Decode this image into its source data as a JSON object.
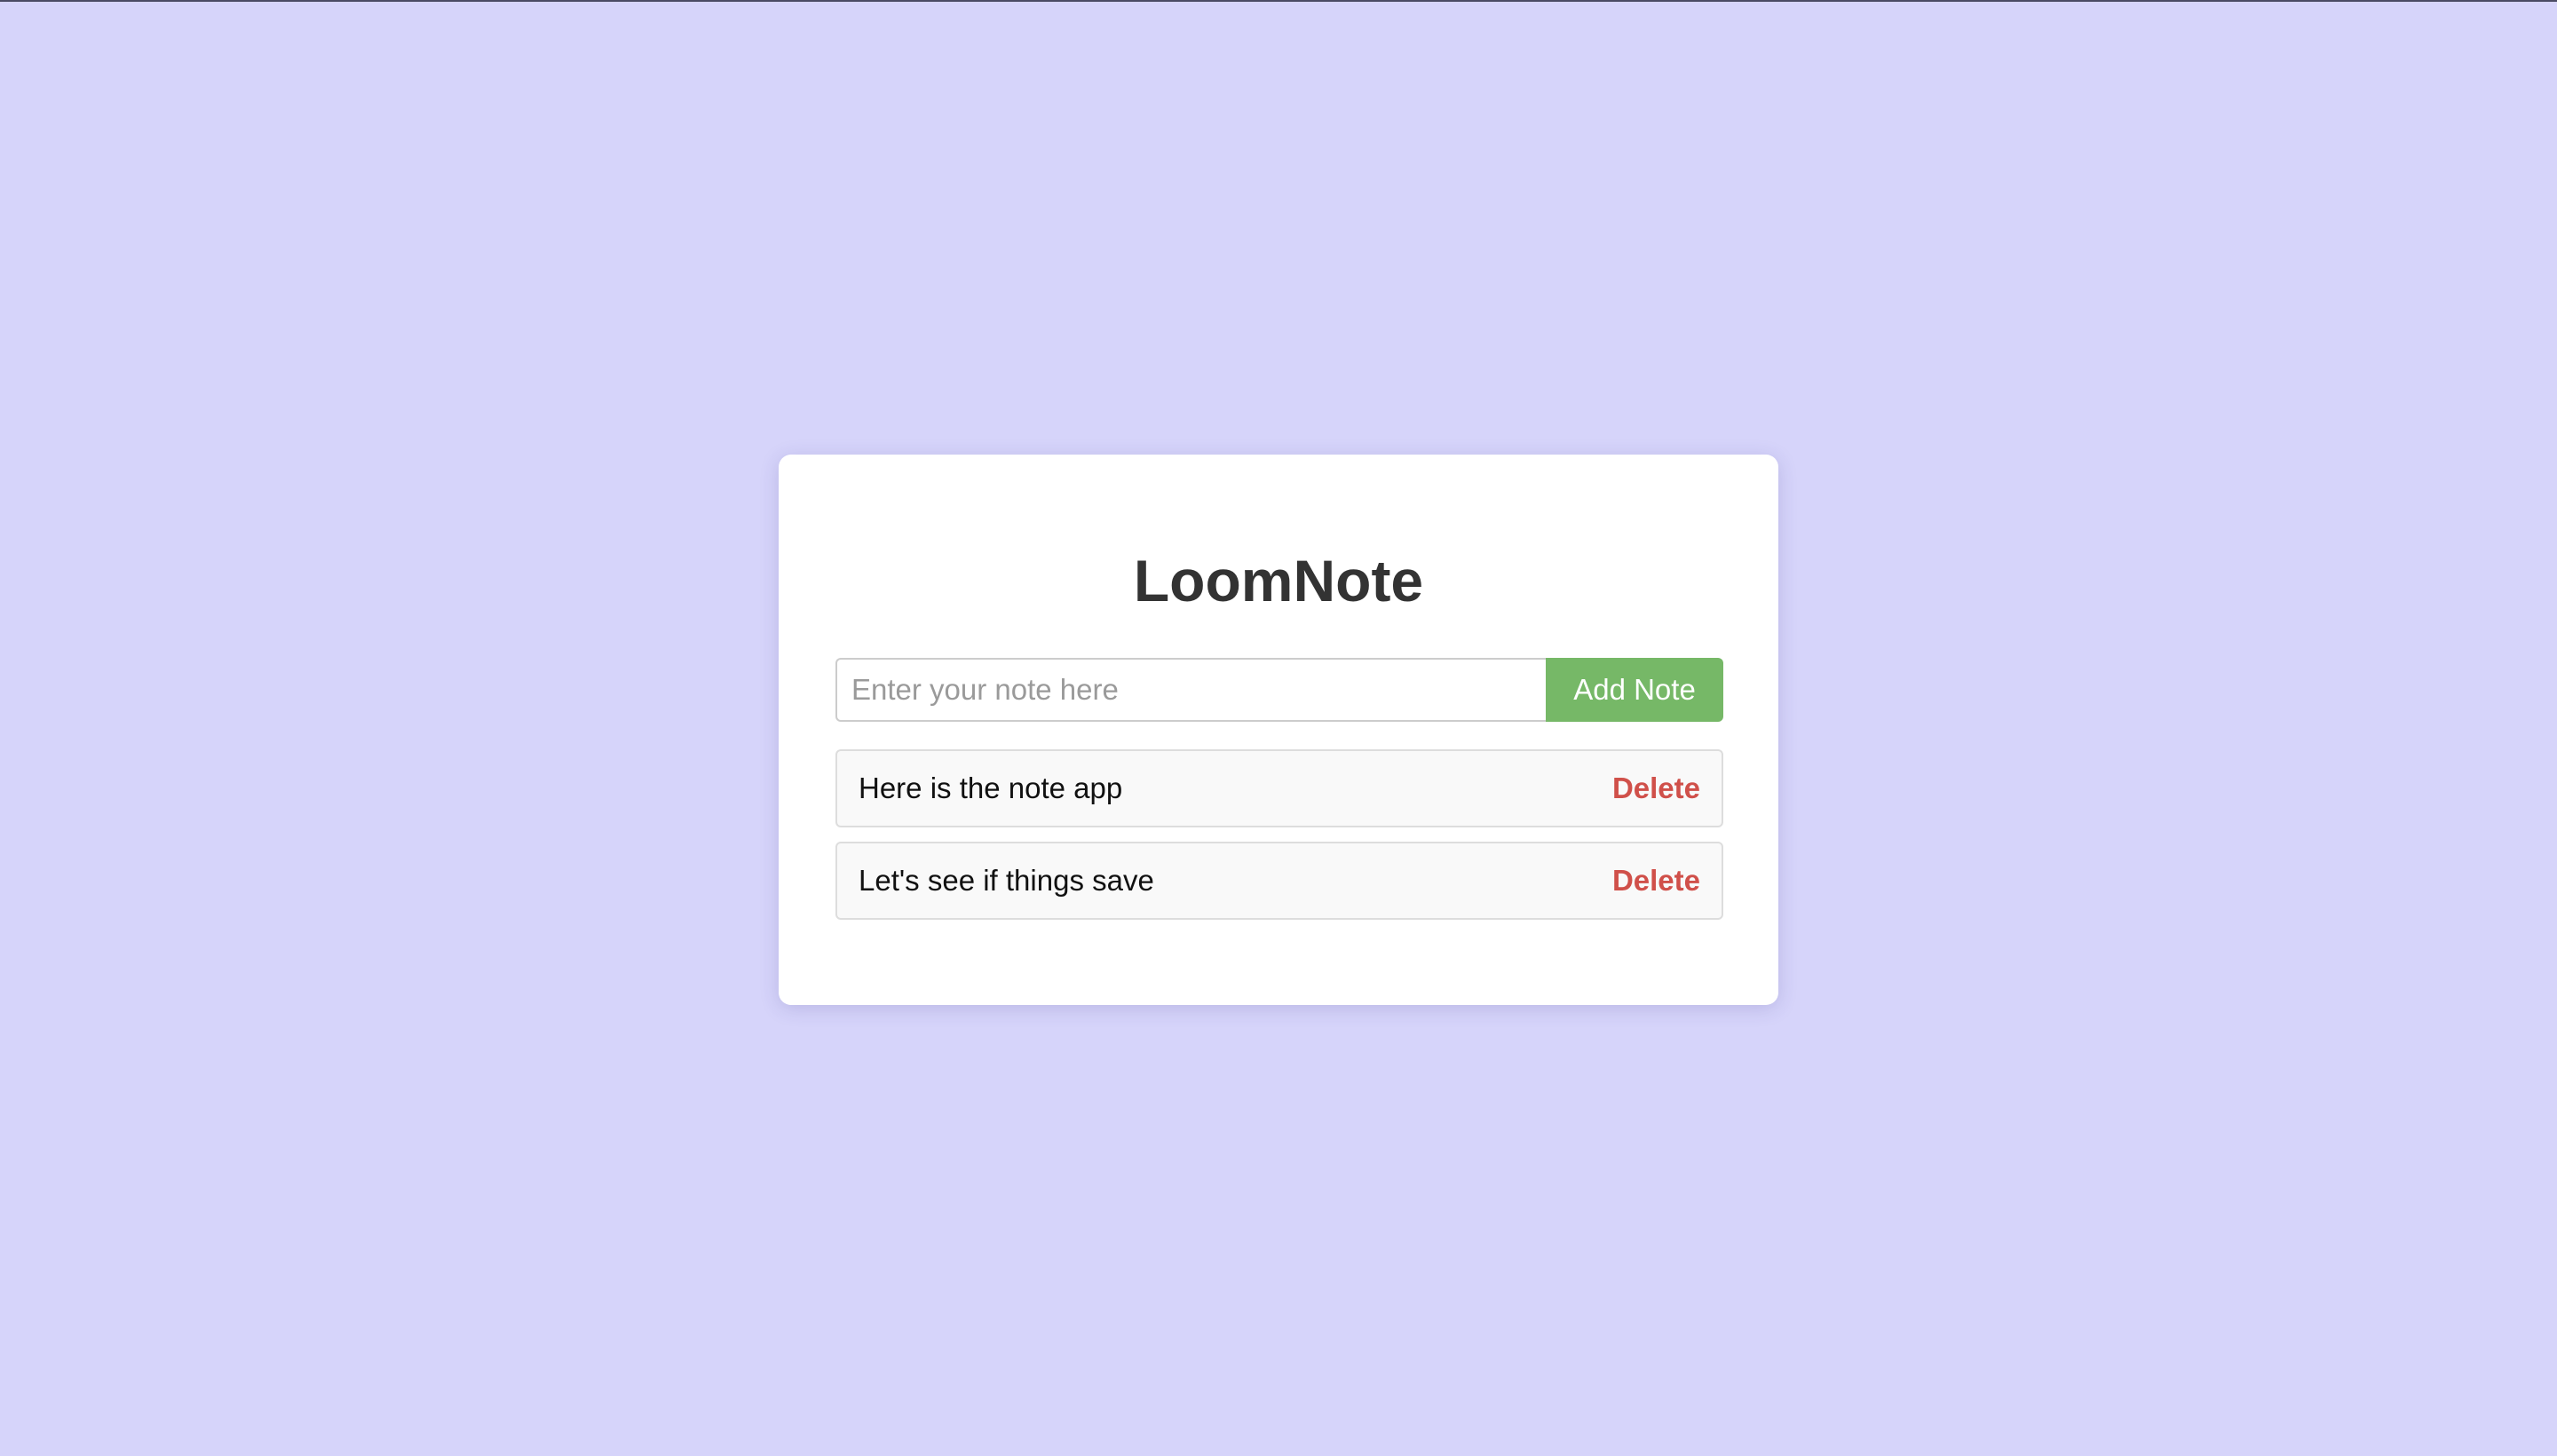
{
  "app": {
    "title": "LoomNote"
  },
  "composer": {
    "placeholder": "Enter your note here",
    "value": "",
    "add_label": "Add Note"
  },
  "notes": [
    {
      "text": "Here is the note app",
      "delete_label": "Delete"
    },
    {
      "text": "Let's see if things save",
      "delete_label": "Delete"
    }
  ],
  "colors": {
    "background": "#d6d4fa",
    "card": "#ffffff",
    "add_button": "#76b867",
    "delete_text": "#d0504a",
    "note_background": "#f9f9f9"
  }
}
